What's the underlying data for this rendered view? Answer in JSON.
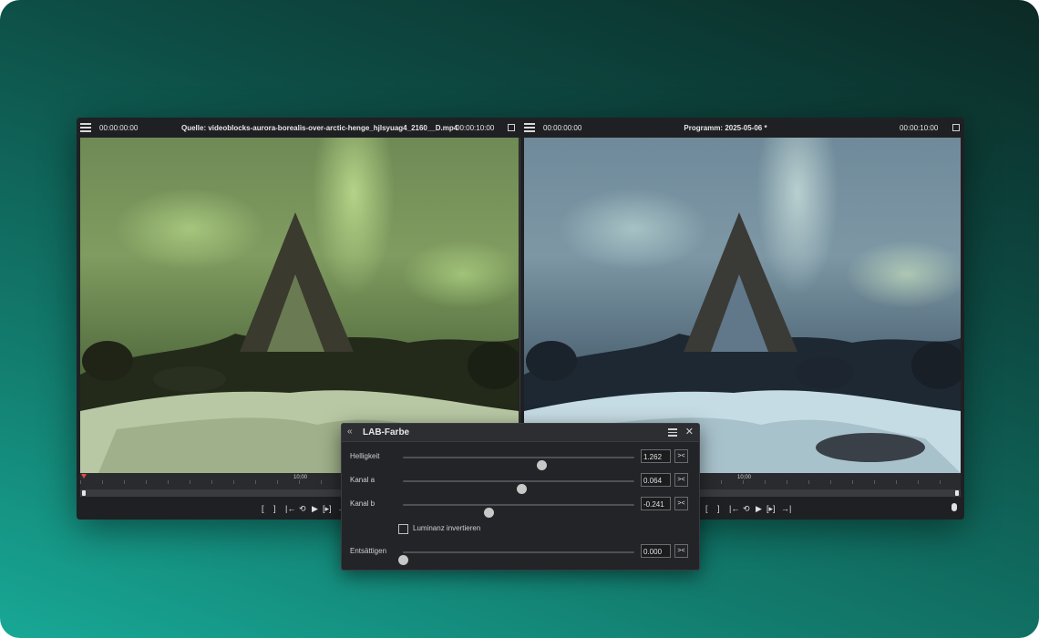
{
  "source_monitor": {
    "timecode_start": "00:00:00:00",
    "title": "Quelle: videoblocks-aurora-borealis-over-arctic-henge_hjlsyuag4_2160__D.mp4",
    "timecode_end": "00:00:10:00",
    "ruler_label": "10;00",
    "controls": [
      "[",
      "]",
      "|←",
      "⟲",
      "▶",
      "[▸]",
      "→|"
    ]
  },
  "program_monitor": {
    "timecode_start": "00:00:00:00",
    "title": "Programm: 2025-05-06 *",
    "timecode_end": "00:00:10:00",
    "ruler_label": "10;00",
    "controls": [
      "[",
      "]",
      "|←",
      "⟲",
      "▶",
      "[▸]",
      "→|"
    ]
  },
  "effect_panel": {
    "title": "LAB-Farbe",
    "params": [
      {
        "label": "Helligkeit",
        "value": "1.262",
        "slider_fraction": 0.6
      },
      {
        "label": "Kanal a",
        "value": "0.064",
        "slider_fraction": 0.51
      },
      {
        "label": "Kanal b",
        "value": "-0.241",
        "slider_fraction": 0.37
      }
    ],
    "checkbox_label": "Luminanz invertieren",
    "desaturate": {
      "label": "Entsättigen",
      "value": "0.000",
      "slider_fraction": 0.0
    },
    "reset_label": "><"
  }
}
